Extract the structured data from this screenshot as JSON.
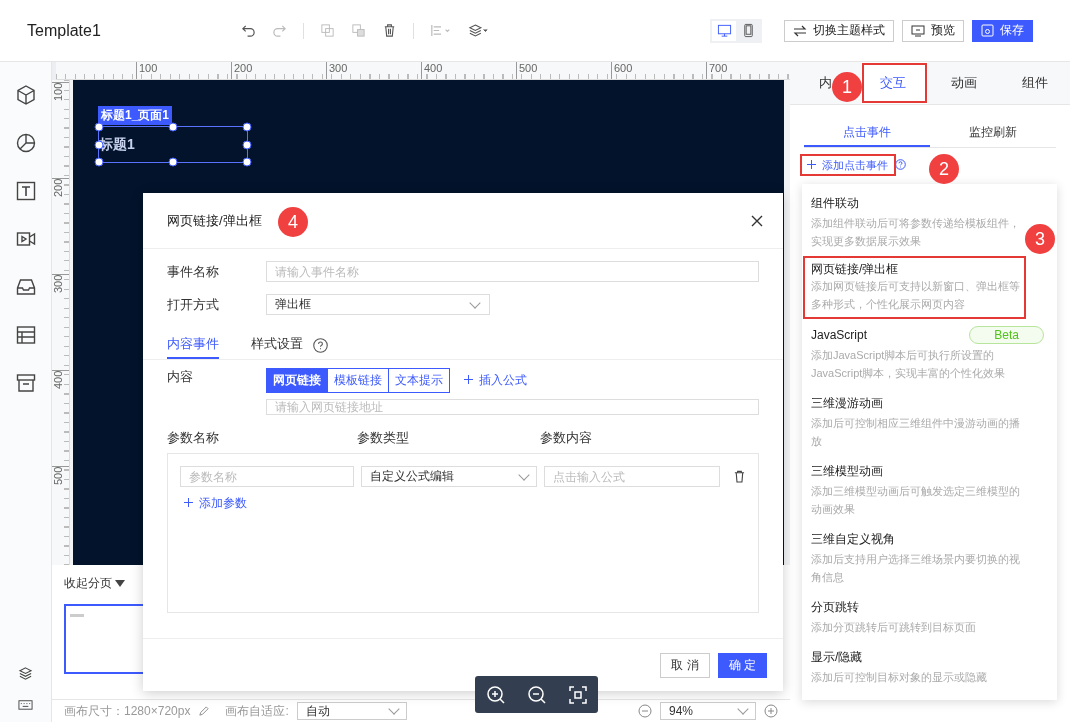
{
  "app": {
    "title": "Template1"
  },
  "toolbar": {
    "device_modes": [
      {
        "kind": "desktop",
        "selected": true
      },
      {
        "kind": "mobile",
        "selected": false
      }
    ],
    "theme_button": "切换主题样式",
    "preview_button": "预览",
    "save_button": "保存"
  },
  "ruler": {
    "x_labels": [
      "100",
      "200",
      "300",
      "400",
      "500",
      "600",
      "700"
    ],
    "y_labels": [
      "100",
      "200",
      "300",
      "400",
      "500"
    ]
  },
  "canvas": {
    "component_tag": "标题1_页面1",
    "component_text": "标题1"
  },
  "pages": {
    "toggle": "收起分页"
  },
  "status_bar": {
    "size_label": "画布尺寸：1280×720px",
    "fit_label": "画布自适应:",
    "fit_value": "自动",
    "zoom": "94%"
  },
  "right_panel": {
    "tabs": [
      {
        "label": "内",
        "selected": false,
        "highlighted": false
      },
      {
        "label": "交互",
        "selected": true,
        "highlighted": true
      },
      {
        "label": "动画",
        "selected": false,
        "highlighted": false
      },
      {
        "label": "组件",
        "selected": false,
        "highlighted": false
      }
    ],
    "subtabs": [
      {
        "label": "点击事件",
        "selected": true
      },
      {
        "label": "监控刷新",
        "selected": false
      }
    ],
    "add_event": {
      "label": "添加点击事件",
      "highlighted": true
    }
  },
  "event_menu": {
    "items": [
      {
        "title": "组件联动",
        "desc": "添加组件联动后可将参数传递给模板组件，实现更多数据展示效果",
        "highlighted": false
      },
      {
        "title": "网页链接/弹出框",
        "desc": "添加网页链接后可支持以新窗口、弹出框等多种形式，个性化展示网页内容",
        "highlighted": true
      },
      {
        "title": "JavaScript",
        "desc": "添加JavaScript脚本后可执行所设置的JavaScript脚本，实现丰富的个性化效果",
        "highlighted": false,
        "badge": "Beta"
      },
      {
        "title": "三维漫游动画",
        "desc": "添加后可控制相应三维组件中漫游动画的播放",
        "highlighted": false
      },
      {
        "title": "三维模型动画",
        "desc": "添加三维模型动画后可触发选定三维模型的动画效果",
        "highlighted": false
      },
      {
        "title": "三维自定义视角",
        "desc": "添加后支持用户选择三维场景内要切换的视角信息",
        "highlighted": false
      },
      {
        "title": "分页跳转",
        "desc": "添加分页跳转后可跳转到目标页面",
        "highlighted": false
      },
      {
        "title": "显示/隐藏",
        "desc": "添加后可控制目标对象的显示或隐藏",
        "highlighted": false
      }
    ]
  },
  "dialog": {
    "title": "网页链接/弹出框",
    "event_name": {
      "label": "事件名称",
      "placeholder": "请输入事件名称"
    },
    "open_mode": {
      "label": "打开方式",
      "value": "弹出框"
    },
    "tabs": [
      {
        "label": "内容事件",
        "selected": true
      },
      {
        "label": "样式设置",
        "selected": false
      }
    ],
    "content": {
      "label": "内容",
      "options": [
        {
          "label": "网页链接",
          "selected": true
        },
        {
          "label": "模板链接",
          "selected": false
        },
        {
          "label": "文本提示",
          "selected": false
        }
      ],
      "insert_formula": "插入公式",
      "url_placeholder": "请输入网页链接地址"
    },
    "params": {
      "columns": [
        "参数名称",
        "参数类型",
        "参数内容"
      ],
      "rows": [
        {
          "name_placeholder": "参数名称",
          "type": "自定义公式编辑",
          "content_placeholder": "点击输入公式"
        }
      ],
      "add": "添加参数"
    },
    "buttons": {
      "cancel": "取 消",
      "ok": "确 定"
    }
  },
  "callouts": [
    {
      "label": "1"
    },
    {
      "label": "2"
    },
    {
      "label": "3"
    },
    {
      "label": "4"
    }
  ]
}
